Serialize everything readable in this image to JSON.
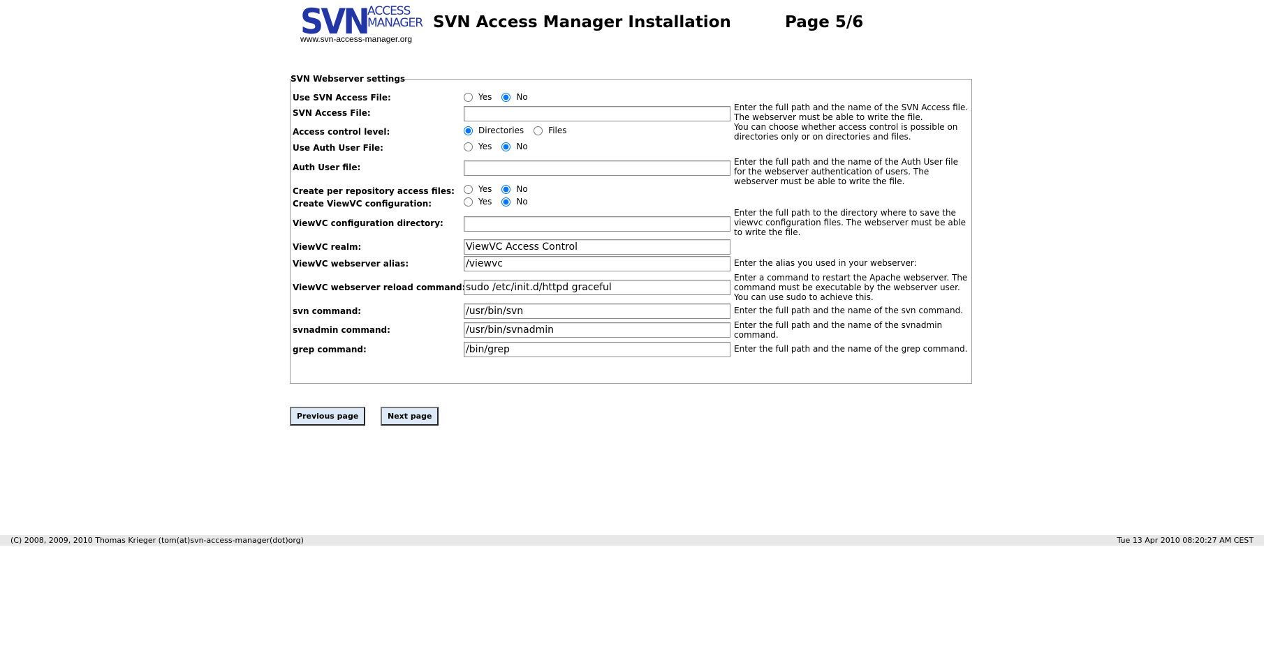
{
  "header": {
    "logo_main": "SVN",
    "logo_sub_line1": "ACCESS",
    "logo_sub_line2": "MANAGER",
    "logo_url": "www.svn-access-manager.org",
    "title": "SVN Access Manager Installation",
    "page": "Page 5/6"
  },
  "fieldset": {
    "legend": "SVN Webserver settings",
    "rows": [
      {
        "label": "Use SVN Access File:",
        "type": "radio",
        "options": [
          "Yes",
          "No"
        ],
        "selected": "No"
      },
      {
        "label": "SVN Access File:",
        "type": "text",
        "value": "",
        "help": "Enter the full path and the name of the SVN Access file. The webserver must be able to write the file."
      },
      {
        "label": "Access control level:",
        "type": "radio",
        "options": [
          "Directories",
          "Files"
        ],
        "selected": "Directories",
        "help": "You can choose whether access control is possible on directories only or on directories and files."
      },
      {
        "label": "Use Auth User File:",
        "type": "radio",
        "options": [
          "Yes",
          "No"
        ],
        "selected": "No"
      },
      {
        "label": "Auth User file:",
        "type": "text",
        "value": "",
        "help": "Enter the full path and the name of the Auth User file for the webserver authentication of users. The webserver must be able to write the file."
      },
      {
        "label": "Create per repository access files:",
        "type": "radio",
        "options": [
          "Yes",
          "No"
        ],
        "selected": "No"
      },
      {
        "label": "Create ViewVC configuration:",
        "type": "radio",
        "options": [
          "Yes",
          "No"
        ],
        "selected": "No"
      },
      {
        "label": "ViewVC configuration directory:",
        "type": "text",
        "value": "",
        "help": "Enter the full path to the directory where to save the viewvc configuration files. The webserver must be able to write the file."
      },
      {
        "label": "ViewVC realm:",
        "type": "text",
        "value": "ViewVC Access Control"
      },
      {
        "label": "ViewVC webserver alias:",
        "type": "text",
        "value": "/viewvc",
        "help": "Enter the alias you used in your webserver:"
      },
      {
        "label": "ViewVC webserver reload command:",
        "type": "text",
        "value": "sudo /etc/init.d/httpd graceful",
        "help": "Enter a command to restart the Apache webserver. The command must be executable by the webserver user. You can use sudo to achieve this."
      },
      {
        "label": "svn command:",
        "type": "text",
        "value": "/usr/bin/svn",
        "help": "Enter the full path and the name of the svn command."
      },
      {
        "label": "svnadmin command:",
        "type": "text",
        "value": "/usr/bin/svnadmin",
        "help": "Enter the full path and the name of the svnadmin command."
      },
      {
        "label": "grep command:",
        "type": "text",
        "value": "/bin/grep",
        "help": "Enter the full path and the name of the grep command."
      }
    ]
  },
  "buttons": {
    "previous": "Previous page",
    "next": "Next page"
  },
  "footer": {
    "copyright": "(C) 2008, 2009, 2010 Thomas Krieger (tom(at)svn-access-manager(dot)org)",
    "timestamp": "Tue 13 Apr 2010 08:20:27 AM CEST"
  },
  "colors": {
    "logo": "#2336a6",
    "button_bg": "#dde9f7",
    "footer_bg": "#e8e8e8"
  }
}
